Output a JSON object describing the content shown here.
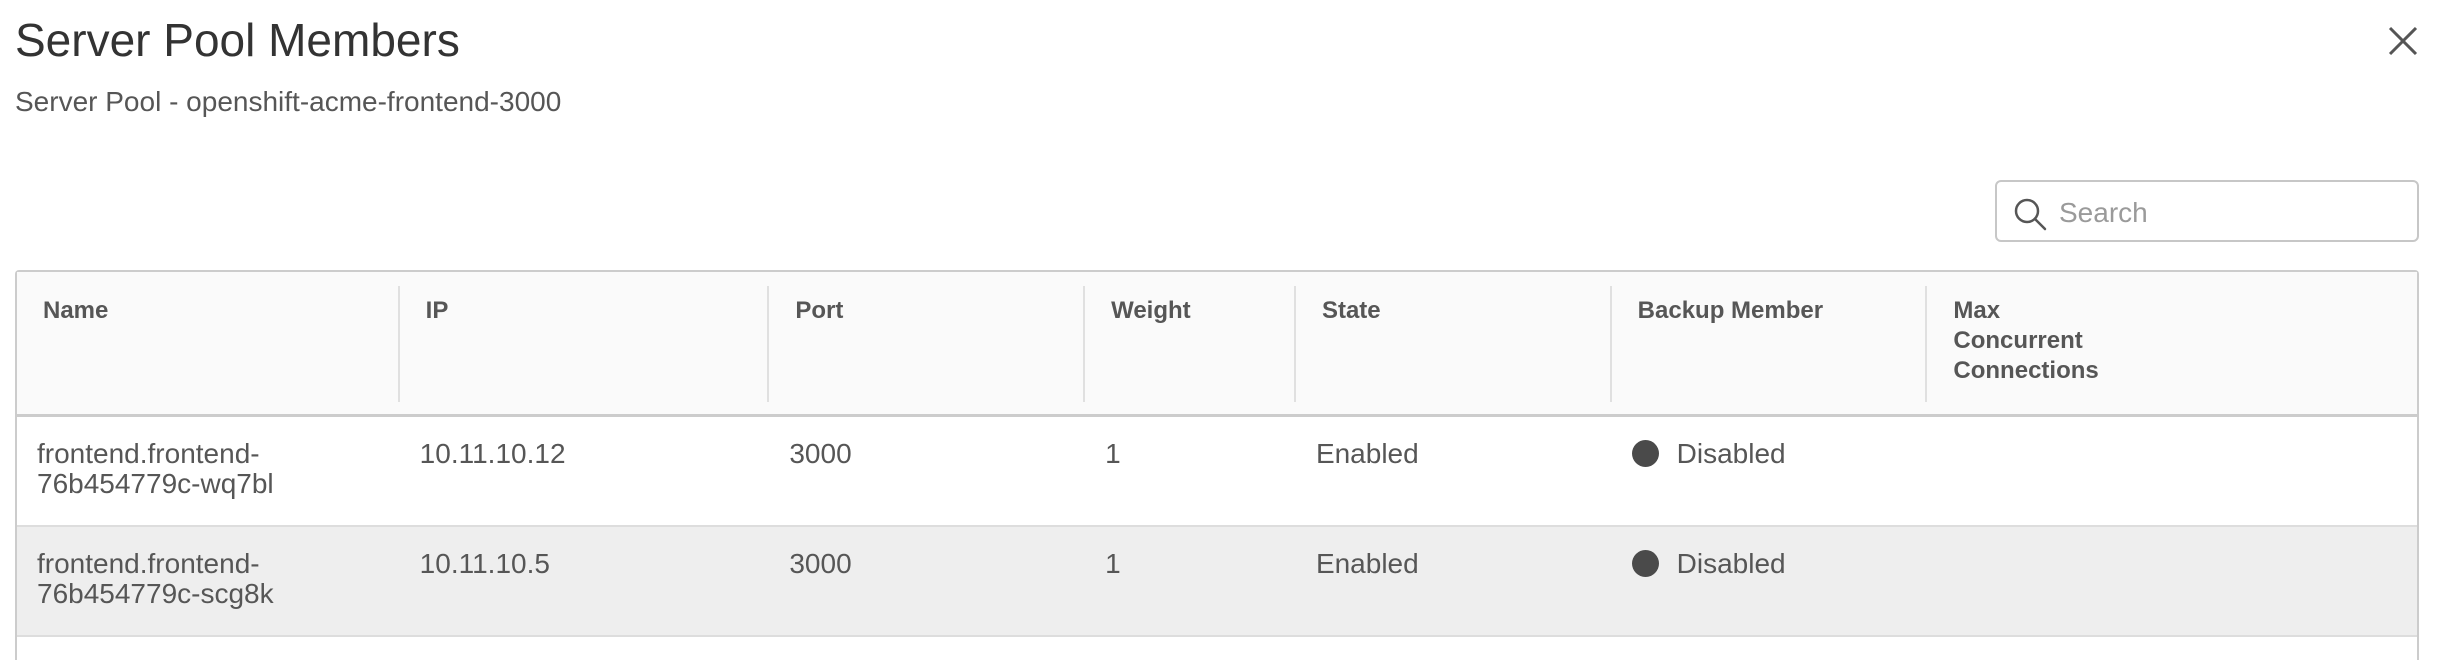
{
  "modal": {
    "title": "Server Pool Members",
    "subtitle": "Server Pool - openshift-acme-frontend-3000",
    "close_icon": "close-icon"
  },
  "search": {
    "placeholder": "Search",
    "value": "",
    "icon": "search-icon"
  },
  "table": {
    "columns": [
      {
        "label": "Name"
      },
      {
        "label": "IP"
      },
      {
        "label": "Port"
      },
      {
        "label": "Weight"
      },
      {
        "label": "State"
      },
      {
        "label": "Backup Member"
      },
      {
        "label": "Max Concurrent Connections",
        "lines": [
          "Max",
          "Concurrent",
          "Connections"
        ]
      }
    ],
    "rows": [
      {
        "name_line1": "frontend.frontend-",
        "name_line2": "76b454779c-wq7bl",
        "ip": "10.11.10.12",
        "port": "3000",
        "weight": "1",
        "state": "Enabled",
        "backup_member": "Disabled",
        "max_concurrent_connections": ""
      },
      {
        "name_line1": "frontend.frontend-",
        "name_line2": "76b454779c-scg8k",
        "ip": "10.11.10.5",
        "port": "3000",
        "weight": "1",
        "state": "Enabled",
        "backup_member": "Disabled",
        "max_concurrent_connections": ""
      }
    ]
  },
  "colors": {
    "text": "#313131",
    "header_text": "#565656",
    "alt_row": "#eeeeee",
    "status_dot": "#4a4a4a",
    "border": "#cccccc"
  }
}
